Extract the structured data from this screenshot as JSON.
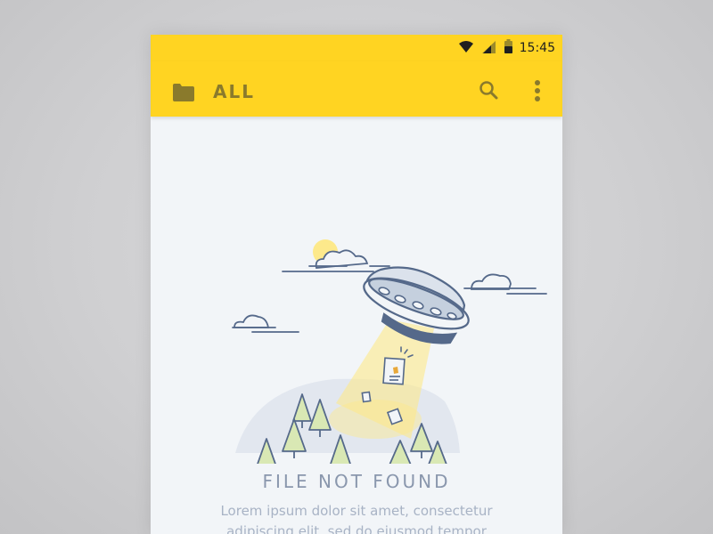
{
  "status_bar": {
    "time": "15:45",
    "icons": [
      "wifi-icon",
      "signal-icon",
      "battery-icon"
    ]
  },
  "app_bar": {
    "title": "ALL",
    "leading_icon": "folder-icon",
    "actions": [
      "search-icon",
      "more-vert-icon"
    ]
  },
  "empty_state": {
    "title": "FILE NOT FOUND",
    "message": "Lorem ipsum dolor sit amet, consectetur adipiscing elit, sed do eiusmod tempor",
    "illustration": "ufo-abducting-files-icon"
  },
  "colors": {
    "accent": "#ffd422",
    "appbar_text": "#8a7a2c",
    "background": "#f2f5f8",
    "illustration_stroke": "#55698a",
    "title_text": "#8a97ad",
    "body_text": "#a8b3c5"
  }
}
